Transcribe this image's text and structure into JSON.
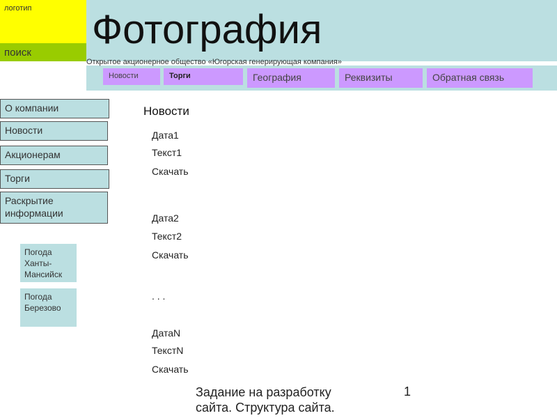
{
  "header": {
    "logo_label": "логотип",
    "search_label": "поиск",
    "title": "Фотография",
    "subtitle": "Открытое акционерное общество «Югорская генерирующая компания»"
  },
  "nav": {
    "items": [
      {
        "label": "Новости"
      },
      {
        "label": "Торги"
      },
      {
        "label": "География"
      },
      {
        "label": "Реквизиты"
      },
      {
        "label": "Обратная связь"
      }
    ]
  },
  "sidebar": {
    "items": [
      {
        "label": "О компании"
      },
      {
        "label": "Новости"
      },
      {
        "label": "Акционерам"
      },
      {
        "label": "Торги"
      },
      {
        "label": "Раскрытие информации"
      }
    ],
    "weather": [
      {
        "label": "Погода Ханты-Мансийск"
      },
      {
        "label": "Погода Березово"
      }
    ]
  },
  "main": {
    "heading": "Новости",
    "news": [
      {
        "date": "Дата1",
        "text": "Текст1",
        "download": "Скачать"
      },
      {
        "date": "Дата2",
        "text": "Текст2",
        "download": "Скачать"
      },
      {
        "date": "ДатаN",
        "text": "ТекстN",
        "download": "Скачать"
      }
    ],
    "ellipsis": ". . ."
  },
  "footer": {
    "caption": "Задание на разработку сайта. Структура сайта.",
    "page_number": "1"
  },
  "colors": {
    "logo": "#ffff00",
    "search": "#99cc00",
    "banner": "#bbdfe1",
    "nav_button": "#cc99ff"
  }
}
